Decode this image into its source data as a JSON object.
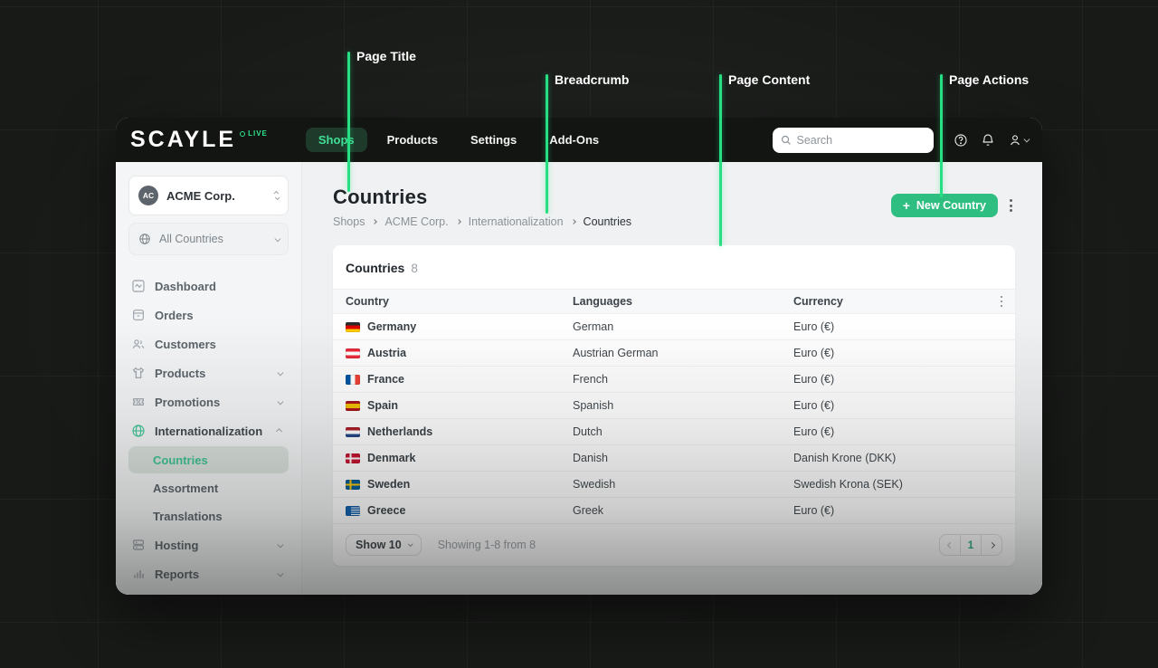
{
  "navbar": {
    "logo": "SCAYLE",
    "env_badge": "LIVE",
    "items": [
      {
        "label": "Shops",
        "active": true
      },
      {
        "label": "Products",
        "active": false
      },
      {
        "label": "Settings",
        "active": false
      },
      {
        "label": "Add-Ons",
        "active": false
      }
    ],
    "search_placeholder": "Search"
  },
  "sidebar": {
    "org": {
      "initials": "AC",
      "name": "ACME Corp."
    },
    "scope": {
      "label": "All Countries"
    },
    "items": [
      {
        "label": "Dashboard"
      },
      {
        "label": "Orders"
      },
      {
        "label": "Customers"
      },
      {
        "label": "Products"
      },
      {
        "label": "Promotions"
      },
      {
        "label": "Internationalization"
      },
      {
        "label": "Hosting"
      },
      {
        "label": "Reports"
      }
    ],
    "intl_children": [
      {
        "label": "Countries",
        "active": true
      },
      {
        "label": "Assortment",
        "active": false
      },
      {
        "label": "Translations",
        "active": false
      }
    ]
  },
  "page": {
    "title": "Countries",
    "breadcrumb": [
      "Shops",
      "ACME Corp.",
      "Internationalization",
      "Countries"
    ],
    "primary_action": "New Country"
  },
  "table": {
    "card_title": "Countries",
    "count": "8",
    "columns": [
      "Country",
      "Languages",
      "Currency"
    ],
    "rows": [
      {
        "country": "Germany",
        "language": "German",
        "currency": "Euro (€)"
      },
      {
        "country": "Austria",
        "language": "Austrian German",
        "currency": "Euro (€)"
      },
      {
        "country": "France",
        "language": "French",
        "currency": "Euro (€)"
      },
      {
        "country": "Spain",
        "language": "Spanish",
        "currency": "Euro (€)"
      },
      {
        "country": "Netherlands",
        "language": "Dutch",
        "currency": "Euro (€)"
      },
      {
        "country": "Denmark",
        "language": "Danish",
        "currency": "Danish Krone (DKK)"
      },
      {
        "country": "Sweden",
        "language": "Swedish",
        "currency": "Swedish Krona (SEK)"
      },
      {
        "country": "Greece",
        "language": "Greek",
        "currency": "Euro (€)"
      }
    ],
    "footer": {
      "show_label": "Show 10",
      "summary": "Showing 1-8 from 8",
      "page": "1"
    }
  },
  "annotations": [
    {
      "label": "Page Title"
    },
    {
      "label": "Breadcrumb"
    },
    {
      "label": "Page Content"
    },
    {
      "label": "Page Actions"
    }
  ],
  "colors": {
    "accent_green": "#2fbe81",
    "annotation_green": "#26df82",
    "nav_active_text": "#41df95",
    "live_badge_green": "#2ee48a"
  }
}
